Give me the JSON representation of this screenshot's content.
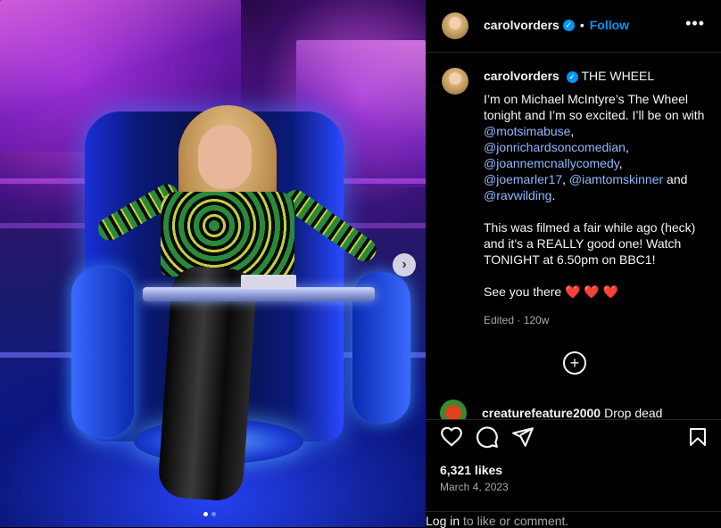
{
  "post": {
    "username": "carolvorders",
    "follow_label": "Follow",
    "separator": "•",
    "more_label": "•••",
    "verified_mark": "✓",
    "caption": {
      "title": "THE WHEEL",
      "line1": "I’m on Michael McIntyre’s The Wheel tonight and I’m so excited. I’ll be on with ",
      "mentions": [
        "@motsimabuse",
        "@jonrichardsoncomedian",
        "@joannemcnallycomedy",
        "@joemarler17",
        "@iamtomskinner",
        "@ravwilding"
      ],
      "and_text": " and ",
      "comma": ",",
      "period": ".",
      "para2": "This was filmed a fair while ago (heck) and it’s a REALLY good one! Watch TONIGHT at 6.50pm on BBC1!",
      "para3": "See you there ❤️ ❤️ ❤️"
    },
    "edited": "Edited · 120w",
    "load_more_icon": "plus-circle-icon",
    "comment": {
      "username": "creaturefeature2000",
      "text": "Drop dead"
    },
    "likes": "6,321 likes",
    "date": "March 4, 2023",
    "login": {
      "link": "Log in",
      "text": " to like or comment."
    },
    "carousel": {
      "next_label": "›",
      "dots": 2,
      "active": 0
    }
  },
  "colors": {
    "accent": "#0095f6",
    "background": "#000000",
    "text": "#f5f5f5",
    "muted": "#a8a8a8"
  },
  "icons": [
    "heart-icon",
    "comment-icon",
    "share-icon",
    "bookmark-icon",
    "chevron-right-icon",
    "verified-icon",
    "more-icon"
  ]
}
